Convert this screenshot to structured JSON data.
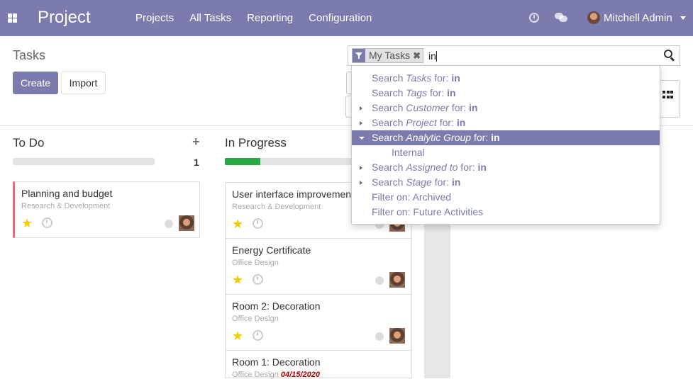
{
  "navbar": {
    "app_name": "Project",
    "menu": [
      "Projects",
      "All Tasks",
      "Reporting",
      "Configuration"
    ],
    "user_name": "Mitchell Admin"
  },
  "control_panel": {
    "title": "Tasks",
    "create_label": "Create",
    "import_label": "Import",
    "search": {
      "facet_label": "My Tasks",
      "facet_close": "✖",
      "query": "in"
    }
  },
  "dropdown": {
    "items": [
      {
        "prefix": "Search ",
        "field": "Tasks",
        "mid": " for: ",
        "value": "in",
        "expandable": false
      },
      {
        "prefix": "Search ",
        "field": "Tags",
        "mid": " for: ",
        "value": "in",
        "expandable": false
      },
      {
        "prefix": "Search ",
        "field": "Customer",
        "mid": " for: ",
        "value": "in",
        "expandable": true
      },
      {
        "prefix": "Search ",
        "field": "Project",
        "mid": " for: ",
        "value": "in",
        "expandable": true
      },
      {
        "prefix": "Search ",
        "field": "Analytic Group",
        "mid": " for: ",
        "value": "in",
        "expandable": true,
        "active": true
      },
      {
        "sub_label": "Internal"
      },
      {
        "prefix": "Search ",
        "field": "Assigned to",
        "mid": " for: ",
        "value": "in",
        "expandable": true
      },
      {
        "prefix": "Search ",
        "field": "Stage",
        "mid": " for: ",
        "value": "in",
        "expandable": true
      },
      {
        "filter": "Filter on: Archived"
      },
      {
        "filter": "Filter on: Future Activities"
      }
    ]
  },
  "kanban": {
    "columns": [
      {
        "title": "To Do",
        "count": "1",
        "progress": 0,
        "cards": [
          {
            "name": "Planning and budget",
            "project": "Research & Development",
            "date": ""
          }
        ]
      },
      {
        "title": "In Progress",
        "count": "",
        "progress": 0.25,
        "cards": [
          {
            "name": "User interface improvements",
            "project": "Research & Development",
            "date": ""
          },
          {
            "name": "Energy Certificate",
            "project": "Office Design",
            "date": ""
          },
          {
            "name": "Room 2: Decoration",
            "project": "Office Design",
            "date": ""
          },
          {
            "name": "Room 1: Decoration",
            "project": "Office Design",
            "date": "04/15/2020"
          }
        ]
      }
    ]
  },
  "colors": {
    "primary": "#7c7bad",
    "progress_green": "#28a745",
    "star": "#f3cc00",
    "deadline_red": "#aa0000"
  },
  "icons": {
    "apps": "apps-grid-icon",
    "activity": "clock-icon",
    "messaging": "chat-icon",
    "filter": "filter-icon",
    "search": "search-icon",
    "kanban_view": "kanban-grid-icon"
  }
}
